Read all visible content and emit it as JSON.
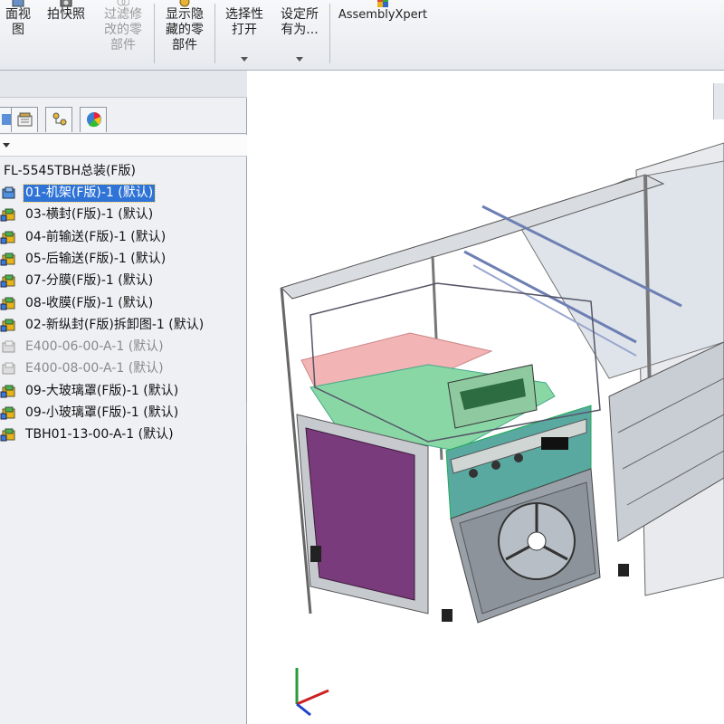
{
  "ribbon": {
    "buttons": [
      {
        "label": "面视\n图",
        "icon": "section-view-icon",
        "enabled": true
      },
      {
        "label": "拍快照",
        "icon": "camera-icon",
        "enabled": true
      },
      {
        "label": "过滤修\n改的零\n部件",
        "icon": "filter-icon",
        "enabled": false
      },
      {
        "label": "显示隐\n藏的零\n部件",
        "icon": "show-hidden-icon",
        "enabled": true
      },
      {
        "label": "选择性\n打开",
        "icon": "open-icon",
        "enabled": true
      },
      {
        "label": "设定所\n有为...",
        "icon": "set-all-icon",
        "enabled": true
      },
      {
        "label": "AssemblyXpert",
        "icon": "assemblyxpert-icon",
        "enabled": true
      }
    ]
  },
  "feature_tree": {
    "root": "FL-5545TBH总装(F版)",
    "items": [
      {
        "label": "01-机架(F版)-1 (默认)",
        "state": "selected"
      },
      {
        "label": "03-横封(F版)-1 (默认)",
        "state": "normal"
      },
      {
        "label": "04-前输送(F版)-1 (默认)",
        "state": "normal"
      },
      {
        "label": "05-后输送(F版)-1 (默认)",
        "state": "normal"
      },
      {
        "label": "07-分膜(F版)-1 (默认)",
        "state": "normal"
      },
      {
        "label": "08-收膜(F版)-1 (默认)",
        "state": "normal"
      },
      {
        "label": "02-新纵封(F版)拆卸图-1 (默认)",
        "state": "normal"
      },
      {
        "label": "E400-06-00-A-1 (默认)",
        "state": "suppressed"
      },
      {
        "label": "E400-08-00-A-1 (默认)",
        "state": "suppressed"
      },
      {
        "label": "09-大玻璃罩(F版)-1 (默认)",
        "state": "normal"
      },
      {
        "label": "09-小玻璃罩(F版)-1 (默认)",
        "state": "normal"
      },
      {
        "label": "TBH01-13-00-A-1 (默认)",
        "state": "normal"
      }
    ]
  },
  "tabs": [
    "feature-manager-tab",
    "property-manager-tab",
    "configuration-manager-tab",
    "display-manager-tab"
  ],
  "colors": {
    "selection": "#2f73d6",
    "suppressed": "#8a8a8a",
    "panel": "#eef0f3"
  }
}
